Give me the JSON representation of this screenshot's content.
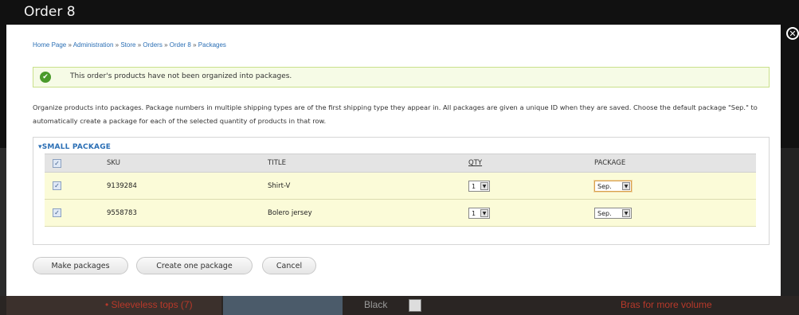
{
  "dialog": {
    "title": "Order 8",
    "close_symbol": "✕"
  },
  "breadcrumb": [
    "Home Page",
    "Administration",
    "Store",
    "Orders",
    "Order 8",
    "Packages"
  ],
  "breadcrumb_separator": "»",
  "status": {
    "message": "This order's products have not been organized into packages."
  },
  "help_text": "Organize products into packages. Package numbers in multiple shipping types are of the first shipping type they appear in. All packages are given a unique ID when they are saved. Choose the default package \"Sep.\" to automatically create a package for each of the selected quantity of products in that row.",
  "fieldset": {
    "legend": "▾SMALL PACKAGE",
    "columns": [
      "SKU",
      "TITLE",
      "QTY",
      "PACKAGE"
    ],
    "rows": [
      {
        "checked": true,
        "sku": "9139284",
        "title": "Shirt-V",
        "qty": "1",
        "package": "Sep."
      },
      {
        "checked": true,
        "sku": "9558783",
        "title": "Bolero jersey",
        "qty": "1",
        "package": "Sep."
      }
    ]
  },
  "buttons": {
    "make_packages": "Make packages",
    "create_one": "Create one package",
    "cancel": "Cancel"
  },
  "background": {
    "left_text": "• Sleeveless tops (7)",
    "color_value": "Black",
    "right_text": "Bras for more volume"
  },
  "colors": {
    "link": "#2b6fb5",
    "status_bg": "#f6fbe6",
    "row_highlight": "#fbfbd8"
  }
}
